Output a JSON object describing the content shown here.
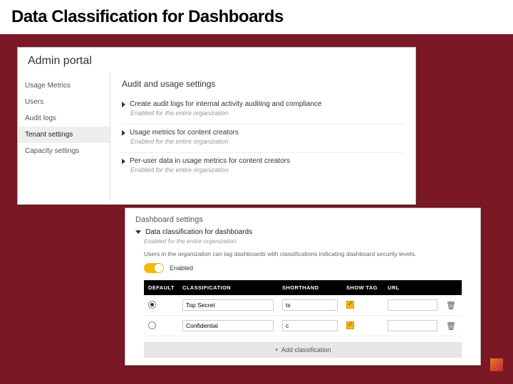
{
  "slide": {
    "title": "Data Classification for Dashboards"
  },
  "portal": {
    "header": "Admin portal",
    "sidebar": {
      "items": [
        {
          "label": "Usage Metrics"
        },
        {
          "label": "Users"
        },
        {
          "label": "Audit logs"
        },
        {
          "label": "Tenant settings"
        },
        {
          "label": "Capacity settings"
        }
      ]
    },
    "section_title": "Audit and usage settings",
    "settings": [
      {
        "title": "Create audit logs for internal activity auditing and compliance",
        "sub": "Enabled for the entire organization"
      },
      {
        "title": "Usage metrics for content creators",
        "sub": "Enabled for the entire organization"
      },
      {
        "title": "Per-user data in usage metrics for content creators",
        "sub": "Enabled for the entire organization"
      }
    ]
  },
  "dashboard_settings": {
    "header": "Dashboard settings",
    "title": "Data classification for dashboards",
    "sub": "Enabled for the entire organization",
    "help": "Users in the organization can tag dashboards with classifications indicating dashboard security levels.",
    "toggle_label": "Enabled",
    "table": {
      "headers": {
        "default": "DEFAULT",
        "classification": "CLASSIFICATION",
        "shorthand": "SHORTHAND",
        "show_tag": "SHOW TAG",
        "url": "URL"
      },
      "rows": [
        {
          "classification": "Top Secret",
          "shorthand": "ts",
          "show_tag": true,
          "default": true,
          "url": ""
        },
        {
          "classification": "Confidential",
          "shorthand": "c",
          "show_tag": true,
          "default": false,
          "url": ""
        }
      ],
      "add_label": "Add classification"
    }
  }
}
